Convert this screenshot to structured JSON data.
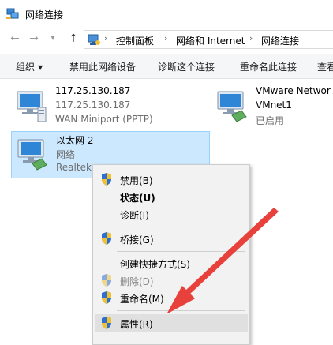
{
  "window": {
    "title": "网络连接",
    "icon": "network-connections-icon"
  },
  "address_bar": {
    "breadcrumbs": [
      "控制面板",
      "网络和 Internet",
      "网络连接"
    ],
    "icon": "control-panel-icon"
  },
  "toolbar": {
    "items": [
      "组织",
      "禁用此网络设备",
      "诊断这个连接",
      "重命名此连接",
      "查看"
    ]
  },
  "connections": [
    {
      "name": "117.25.130.187",
      "status": "117.25.130.187",
      "device": "WAN Miniport (PPTP)",
      "icon": "vpn-connection-icon",
      "selected": false
    },
    {
      "name": "VMware Networ",
      "status": "VMnet1",
      "device": "已启用",
      "icon": "network-adapter-icon",
      "selected": false
    },
    {
      "name": "以太网 2",
      "status": "网络",
      "device": "Realtek",
      "icon": "ethernet-adapter-icon",
      "selected": true
    }
  ],
  "context_menu": {
    "items": [
      {
        "label": "禁用(B)",
        "shield": true,
        "bold": false,
        "disabled": false,
        "highlighted": false
      },
      {
        "label": "状态(U)",
        "shield": false,
        "bold": true,
        "disabled": false,
        "highlighted": false
      },
      {
        "label": "诊断(I)",
        "shield": false,
        "bold": false,
        "disabled": false,
        "highlighted": false
      },
      {
        "label": "桥接(G)",
        "shield": true,
        "bold": false,
        "disabled": false,
        "highlighted": false
      },
      {
        "label": "创建快捷方式(S)",
        "shield": false,
        "bold": false,
        "disabled": false,
        "highlighted": false
      },
      {
        "label": "删除(D)",
        "shield": true,
        "bold": false,
        "disabled": true,
        "highlighted": false
      },
      {
        "label": "重命名(M)",
        "shield": true,
        "bold": false,
        "disabled": false,
        "highlighted": false
      },
      {
        "label": "属性(R)",
        "shield": true,
        "bold": false,
        "disabled": false,
        "highlighted": true
      }
    ]
  },
  "colors": {
    "selection_bg": "#cce8ff",
    "annotation_arrow": "#e8413c"
  }
}
